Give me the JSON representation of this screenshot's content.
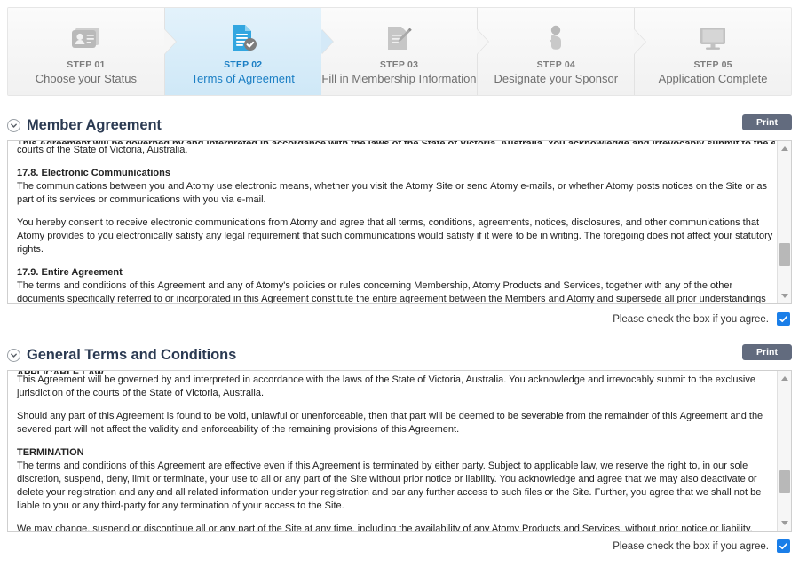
{
  "stepper": {
    "steps": [
      {
        "num": "STEP 01",
        "label": "Choose your Status",
        "icon": "id-card-icon",
        "active": false
      },
      {
        "num": "STEP 02",
        "label": "Terms of Agreement",
        "icon": "document-check-icon",
        "active": true
      },
      {
        "num": "STEP 03",
        "label": "Fill in Membership Information",
        "icon": "form-pencil-icon",
        "active": false
      },
      {
        "num": "STEP 04",
        "label": "Designate your Sponsor",
        "icon": "person-hand-icon",
        "active": false
      },
      {
        "num": "STEP 05",
        "label": "Application Complete",
        "icon": "monitor-icon",
        "active": false
      }
    ]
  },
  "colors": {
    "accent": "#1b7fc4",
    "checkbox": "#1a7ee8",
    "print_button": "#626b7e",
    "heading": "#2b3a52",
    "active_step_bg": "#cfe8f7"
  },
  "member_agreement": {
    "title": "Member Agreement",
    "collapse_icon": "chevron-down-icon",
    "print_label": "Print",
    "clipped_line": "This Agreement will be governed by and interpreted in accordance with the laws of the State of Victoria, Australia. You acknowledge and irrevocably submit to the exclusive jurisdiction of the",
    "paragraphs": [
      {
        "type": "text",
        "text": "courts of the State of Victoria, Australia."
      },
      {
        "type": "heading",
        "text": "17.8. Electronic Communications"
      },
      {
        "type": "text",
        "text": "The communications between you and Atomy use electronic means, whether you visit the Atomy Site or send Atomy e-mails, or whether Atomy posts notices on the Site or as part of its services or communications with you via e-mail."
      },
      {
        "type": "text",
        "text": "You hereby consent to receive electronic communications from Atomy and agree that all terms, conditions, agreements, notices, disclosures, and other communications that Atomy provides to you electronically satisfy any legal requirement that such communications would satisfy if it were to be in writing. The foregoing does not affect your statutory rights."
      },
      {
        "type": "heading",
        "text": "17.9. Entire Agreement"
      },
      {
        "type": "text",
        "text": "The terms and conditions of this Agreement and any of Atomy's policies or rules concerning Membership, Atomy Products and Services, together with any of the other documents specifically referred to or incorporated in this Agreement constitute the entire agreement between the Members and Atomy and supersede all prior understandings and agreements concerning its subject matter."
      }
    ],
    "agree_text": "Please check the box if you agree.",
    "agree_checked": true,
    "scrollbar": {
      "up_icon": "scroll-up-arrow-icon",
      "down_icon": "scroll-down-arrow-icon",
      "thumb_top_pct": 78
    }
  },
  "general_terms": {
    "title": "General Terms and Conditions",
    "collapse_icon": "chevron-down-icon",
    "print_label": "Print",
    "clipped_line": "APPLICABLE LAW",
    "paragraphs": [
      {
        "type": "text",
        "text": "This Agreement will be governed by and interpreted in accordance with the laws of the State of Victoria, Australia. You acknowledge and irrevocably submit to the exclusive jurisdiction of the courts of the State of Victoria, Australia."
      },
      {
        "type": "text",
        "text": "Should any part of this Agreement is found to be void, unlawful or unenforceable, then that part will be deemed to be severable from the remainder of this Agreement and the severed part will not affect the validity and enforceability of the remaining provisions of this Agreement."
      },
      {
        "type": "heading",
        "text": "TERMINATION"
      },
      {
        "type": "text",
        "text": "The terms and conditions of this Agreement are effective even if this Agreement is terminated by either party. Subject to applicable law, we reserve the right to, in our sole discretion, suspend, deny, limit or terminate, your use to all or any part of the Site without prior notice or liability. You acknowledge and agree that we may also deactivate or delete your registration and any and all related information under your registration and bar any further access to such files or the Site. Further, you agree that we shall not be liable to you or any third-party for any termination of your access to the Site."
      },
      {
        "type": "text",
        "text": "We may change, suspend or discontinue all or any part of the Site at any time, including the availability of any Atomy Products and Services, without prior notice or liability."
      }
    ],
    "agree_text": "Please check the box if you agree.",
    "agree_checked": true,
    "scrollbar": {
      "up_icon": "scroll-up-arrow-icon",
      "down_icon": "scroll-down-arrow-icon",
      "thumb_top_pct": 78
    }
  }
}
